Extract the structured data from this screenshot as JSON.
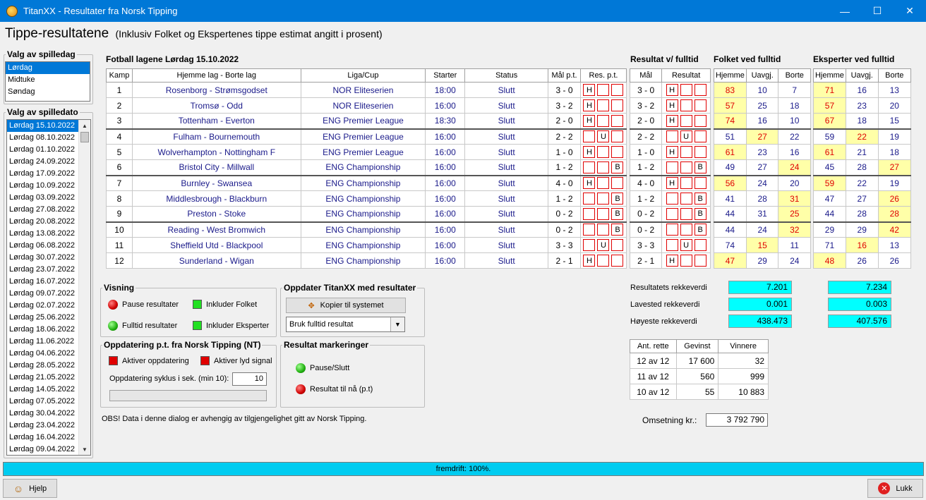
{
  "window": {
    "title": "TitanXX - Resultater fra Norsk Tipping",
    "minimize": "—",
    "maximize": "☐",
    "close": "✕"
  },
  "heading": {
    "title": "Tippe-resultatene",
    "subtitle": "(Inklusiv Folket og Ekspertenes tippe estimat angitt i prosent)"
  },
  "day_group": {
    "label": "Valg av spilledag",
    "items": [
      "Lørdag",
      "Midtuke",
      "Søndag"
    ],
    "selected": 0
  },
  "date_group": {
    "label": "Valg av spilledato",
    "selected": 0,
    "items": [
      "Lørdag 15.10.2022",
      "Lørdag 08.10.2022",
      "Lørdag 01.10.2022",
      "Lørdag 24.09.2022",
      "Lørdag 17.09.2022",
      "Lørdag 10.09.2022",
      "Lørdag 03.09.2022",
      "Lørdag 27.08.2022",
      "Lørdag 20.08.2022",
      "Lørdag 13.08.2022",
      "Lørdag 06.08.2022",
      "Lørdag 30.07.2022",
      "Lørdag 23.07.2022",
      "Lørdag 16.07.2022",
      "Lørdag 09.07.2022",
      "Lørdag 02.07.2022",
      "Lørdag 25.06.2022",
      "Lørdag 18.06.2022",
      "Lørdag 11.06.2022",
      "Lørdag 04.06.2022",
      "Lørdag 28.05.2022",
      "Lørdag 21.05.2022",
      "Lørdag 14.05.2022",
      "Lørdag 07.05.2022",
      "Lørdag 30.04.2022",
      "Lørdag 23.04.2022",
      "Lørdag 16.04.2022",
      "Lørdag 09.04.2022"
    ]
  },
  "section_titles": {
    "matches": "Fotball lagene Lørdag 15.10.2022",
    "fulltime": "Resultat v/ fulltid",
    "folket": "Folket ved fulltid",
    "eksperter": "Eksperter ved fulltid"
  },
  "match_headers": [
    "Kamp",
    "Hjemme lag - Borte lag",
    "Liga/Cup",
    "Starter",
    "Status",
    "Mål p.t.",
    "Res. p.t."
  ],
  "ft_headers": [
    "Mål",
    "Resultat"
  ],
  "pct_headers": [
    "Hjemme",
    "Uavgj.",
    "Borte"
  ],
  "matches": [
    {
      "n": "1",
      "teams": "Rosenborg - Strømsgodset",
      "league": "NOR Eliteserien",
      "start": "18:00",
      "status": "Slutt",
      "goals": "3 - 0",
      "res": "H",
      "ft": "3 - 0",
      "folket": [
        "83",
        "10",
        "7"
      ],
      "eksp": [
        "71",
        "16",
        "13"
      ]
    },
    {
      "n": "2",
      "teams": "Tromsø - Odd",
      "league": "NOR Eliteserien",
      "start": "16:00",
      "status": "Slutt",
      "goals": "3 - 2",
      "res": "H",
      "ft": "3 - 2",
      "folket": [
        "57",
        "25",
        "18"
      ],
      "eksp": [
        "57",
        "23",
        "20"
      ]
    },
    {
      "n": "3",
      "teams": "Tottenham - Everton",
      "league": "ENG Premier League",
      "start": "18:30",
      "status": "Slutt",
      "goals": "2 - 0",
      "res": "H",
      "ft": "2 - 0",
      "folket": [
        "74",
        "16",
        "10"
      ],
      "eksp": [
        "67",
        "18",
        "15"
      ]
    },
    {
      "n": "4",
      "teams": "Fulham - Bournemouth",
      "league": "ENG Premier League",
      "start": "16:00",
      "status": "Slutt",
      "goals": "2 - 2",
      "res": "U",
      "ft": "2 - 2",
      "folket": [
        "51",
        "27",
        "22"
      ],
      "eksp": [
        "59",
        "22",
        "19"
      ]
    },
    {
      "n": "5",
      "teams": "Wolverhampton - Nottingham F",
      "league": "ENG Premier League",
      "start": "16:00",
      "status": "Slutt",
      "goals": "1 - 0",
      "res": "H",
      "ft": "1 - 0",
      "folket": [
        "61",
        "23",
        "16"
      ],
      "eksp": [
        "61",
        "21",
        "18"
      ]
    },
    {
      "n": "6",
      "teams": "Bristol City - Millwall",
      "league": "ENG Championship",
      "start": "16:00",
      "status": "Slutt",
      "goals": "1 - 2",
      "res": "B",
      "ft": "1 - 2",
      "folket": [
        "49",
        "27",
        "24"
      ],
      "eksp": [
        "45",
        "28",
        "27"
      ]
    },
    {
      "n": "7",
      "teams": "Burnley - Swansea",
      "league": "ENG Championship",
      "start": "16:00",
      "status": "Slutt",
      "goals": "4 - 0",
      "res": "H",
      "ft": "4 - 0",
      "folket": [
        "56",
        "24",
        "20"
      ],
      "eksp": [
        "59",
        "22",
        "19"
      ]
    },
    {
      "n": "8",
      "teams": "Middlesbrough - Blackburn",
      "league": "ENG Championship",
      "start": "16:00",
      "status": "Slutt",
      "goals": "1 - 2",
      "res": "B",
      "ft": "1 - 2",
      "folket": [
        "41",
        "28",
        "31"
      ],
      "eksp": [
        "47",
        "27",
        "26"
      ]
    },
    {
      "n": "9",
      "teams": "Preston - Stoke",
      "league": "ENG Championship",
      "start": "16:00",
      "status": "Slutt",
      "goals": "0 - 2",
      "res": "B",
      "ft": "0 - 2",
      "folket": [
        "44",
        "31",
        "25"
      ],
      "eksp": [
        "44",
        "28",
        "28"
      ]
    },
    {
      "n": "10",
      "teams": "Reading - West Bromwich",
      "league": "ENG Championship",
      "start": "16:00",
      "status": "Slutt",
      "goals": "0 - 2",
      "res": "B",
      "ft": "0 - 2",
      "folket": [
        "44",
        "24",
        "32"
      ],
      "eksp": [
        "29",
        "29",
        "42"
      ]
    },
    {
      "n": "11",
      "teams": "Sheffield Utd - Blackpool",
      "league": "ENG Championship",
      "start": "16:00",
      "status": "Slutt",
      "goals": "3 - 3",
      "res": "U",
      "ft": "3 - 3",
      "folket": [
        "74",
        "15",
        "11"
      ],
      "eksp": [
        "71",
        "16",
        "13"
      ]
    },
    {
      "n": "12",
      "teams": "Sunderland - Wigan",
      "league": "ENG Championship",
      "start": "16:00",
      "status": "Slutt",
      "goals": "2 - 1",
      "res": "H",
      "ft": "2 - 1",
      "folket": [
        "47",
        "29",
        "24"
      ],
      "eksp": [
        "48",
        "26",
        "26"
      ]
    }
  ],
  "visning": {
    "label": "Visning",
    "pause": "Pause resultater",
    "fulltid": "Fulltid resultater",
    "folket": "Inkluder Folket",
    "eksperter": "Inkluder Eksperter"
  },
  "oppdater": {
    "label": "Oppdater TitanXX med resultater",
    "copy_button": "Kopier til systemet",
    "select_value": "Bruk fulltid resultat"
  },
  "nt": {
    "label": "Oppdatering p.t. fra Norsk Tipping (NT)",
    "aktiver": "Aktiver oppdatering",
    "lyd": "Aktiver lyd signal",
    "syklus_label": "Oppdatering syklus i sek. (min 10):",
    "syklus_value": "10"
  },
  "markering": {
    "label": "Resultat markeringer",
    "pause": "Pause/Slutt",
    "pt": "Resultat til nå (p.t)"
  },
  "obs": "OBS! Data i denne dialog er avhengig av tilgjengelighet gitt av Norsk Tipping.",
  "rekke": {
    "rows": [
      {
        "label": "Resultatets rekkeverdi",
        "folket": "7.201",
        "eksp": "7.234"
      },
      {
        "label": "Lavested rekkeverdi",
        "folket": "0.001",
        "eksp": "0.003"
      },
      {
        "label": "Høyeste rekkeverdi",
        "folket": "438.473",
        "eksp": "407.576"
      }
    ]
  },
  "gevinst": {
    "headers": [
      "Ant. rette",
      "Gevinst",
      "Vinnere"
    ],
    "rows": [
      [
        "12 av 12",
        "17 600",
        "32"
      ],
      [
        "11 av 12",
        "560",
        "999"
      ],
      [
        "10 av 12",
        "55",
        "10 883"
      ]
    ]
  },
  "omsetning": {
    "label": "Omsetning kr.:",
    "value": "3 792 790"
  },
  "progress": {
    "text": "fremdrift: 100%.",
    "percent": 100
  },
  "footer": {
    "help": "Hjelp",
    "close": "Lukk"
  }
}
